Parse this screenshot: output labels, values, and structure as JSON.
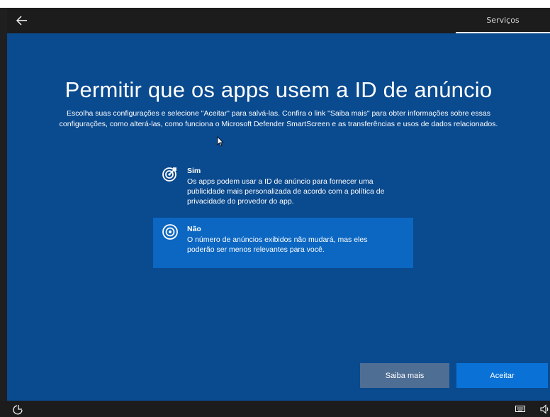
{
  "header": {
    "back_icon": "arrow-left-icon",
    "tab_label": "Serviços"
  },
  "main": {
    "title": "Permitir que os apps usem a ID de anúncio",
    "subtitle_line1": "Escolha suas configurações e selecione \"Aceitar\" para salvá-las. Confira o link \"Saiba mais\" para obter informações sobre essas",
    "subtitle_line2": "configurações, como alterá-las, como funciona o Microsoft Defender SmartScreen e as transferências e usos de dados relacionados.",
    "options": [
      {
        "icon": "target-arrow-icon",
        "title": "Sim",
        "desc_line1": "Os apps podem usar a ID de anúncio para fornecer uma",
        "desc_line2": "publicidade mais personalizada de acordo com a política de",
        "desc_line3": "privacidade do provedor do app.",
        "selected": false
      },
      {
        "icon": "target-icon",
        "title": "Não",
        "desc_line1": "O número de anúncios exibidos não mudará, mas eles",
        "desc_line2": "poderão ser menos relevantes para você.",
        "selected": true
      }
    ],
    "buttons": {
      "learn_more": "Saiba mais",
      "accept": "Aceitar"
    }
  },
  "footer": {
    "ease_icon": "ease-of-access-icon",
    "keyboard_icon": "keyboard-icon",
    "volume_icon": "volume-icon"
  },
  "colors": {
    "background": "#0a4a8f",
    "selected_option": "#0b67c2",
    "learn_more_button": "#4f6e94",
    "accept_button": "#0a72d6",
    "bars": "#1c1c1c"
  }
}
